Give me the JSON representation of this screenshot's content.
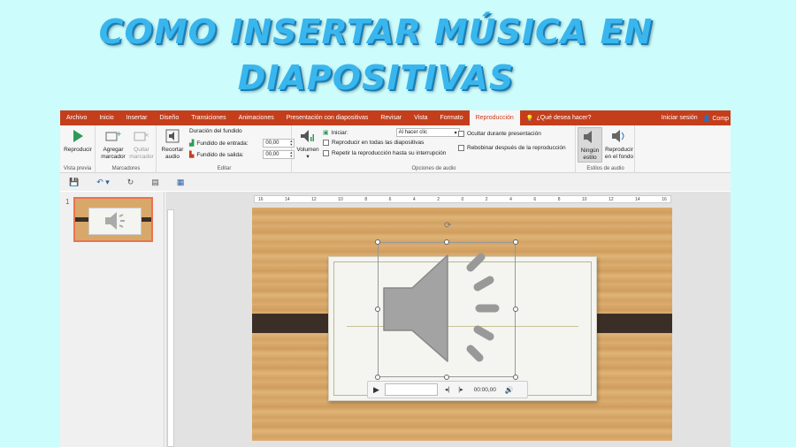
{
  "heading": {
    "line1": "COMO INSERTAR MÚSICA EN",
    "line2": "DIAPOSITIVAS"
  },
  "tabs": [
    "Archivo",
    "Inicio",
    "Insertar",
    "Diseño",
    "Transiciones",
    "Animaciones",
    "Presentación con diapositivas",
    "Revisar",
    "Vista",
    "Formato",
    "Reproducción"
  ],
  "tellme": "¿Qué desea hacer?",
  "signin": "Iniciar sesión",
  "share": "Comp",
  "ribbon": {
    "preview": {
      "play": "Reproducir",
      "group": "Vista previa"
    },
    "bookmarks": {
      "add_line1": "Agregar",
      "add_line2": "marcador",
      "remove_line1": "Quitar",
      "remove_line2": "marcador",
      "group": "Marcadores"
    },
    "edit": {
      "trim_line1": "Recortar",
      "trim_line2": "audio",
      "fade_title": "Duración del fundido",
      "fade_in_label": "Fundido de entrada:",
      "fade_in_value": "00,00",
      "fade_out_label": "Fundido de salida:",
      "fade_out_value": "00,00",
      "group": "Editar"
    },
    "audio_options": {
      "volume": "Volumen",
      "start_label": "Iniciar:",
      "start_value": "Al hacer clic",
      "play_all": "Reproducir en todas las diapositivas",
      "loop": "Repetir la reproducción hasta su interrupción",
      "hide": "Ocultar durante presentación",
      "rewind": "Rebobinar después de la reproducción",
      "group": "Opciones de audio"
    },
    "styles": {
      "none_line1": "Ningún",
      "none_line2": "estilo",
      "bg_line1": "Reproducir",
      "bg_line2": "en el fondo",
      "group": "Estilos de audio"
    }
  },
  "slides": {
    "number": "1"
  },
  "ruler_ticks": [
    "16",
    "14",
    "12",
    "10",
    "8",
    "6",
    "4",
    "2",
    "0",
    "2",
    "4",
    "6",
    "8",
    "10",
    "12",
    "14",
    "16"
  ],
  "player": {
    "time": "00:00,00"
  },
  "colors": {
    "accent": "#c43e1c",
    "title": "#3ab6ee",
    "background": "#ccfcfc"
  }
}
